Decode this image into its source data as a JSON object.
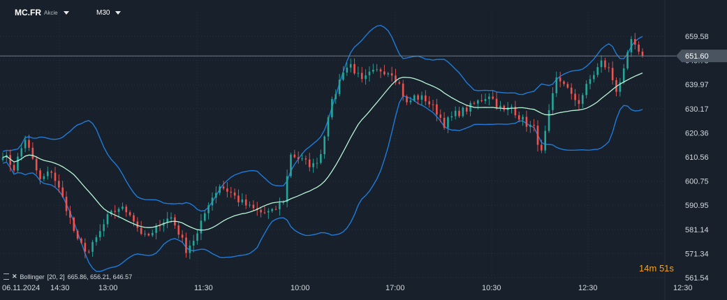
{
  "header": {
    "symbol": "MC.FR",
    "type": "Akcie",
    "timeframe": "M30"
  },
  "legend": {
    "indicator": "Bollinger",
    "params": "[20, 2]",
    "values": "665.86, 656.21, 646.57"
  },
  "timer": {
    "minutes": "14",
    "minutes_unit": "m",
    "seconds": "51",
    "seconds_unit": "s"
  },
  "colors": {
    "background": "#18212b",
    "bull": "#26a69a",
    "bear": "#ef5350",
    "band": "#1e7bd9",
    "middle": "#b8f5d6",
    "grid": "#26313c",
    "price_line": "#7d8793"
  },
  "chart_data": {
    "type": "candlestick",
    "ylim": [
      561.54,
      667.0
    ],
    "y_ticks": [
      "659.58",
      "649.78",
      "639.97",
      "630.17",
      "620.36",
      "610.56",
      "600.75",
      "590.95",
      "581.14",
      "571.34",
      "561.54"
    ],
    "x_ticks": [
      "06.11.2024",
      "14:30",
      "13:00",
      "11:30",
      "10:00",
      "17:00",
      "10:30",
      "12:30",
      "12:30"
    ],
    "current_price": "651.60",
    "path_anchors": [
      [
        0,
        612
      ],
      [
        3,
        606
      ],
      [
        6,
        618
      ],
      [
        8,
        609
      ],
      [
        10,
        601
      ],
      [
        13,
        605
      ],
      [
        17,
        590
      ],
      [
        20,
        576
      ],
      [
        23,
        572
      ],
      [
        26,
        580
      ],
      [
        28,
        586
      ],
      [
        31,
        590
      ],
      [
        34,
        588
      ],
      [
        36,
        582
      ],
      [
        38,
        578
      ],
      [
        40,
        579
      ],
      [
        42,
        584
      ],
      [
        45,
        586
      ],
      [
        47,
        580
      ],
      [
        49,
        573
      ],
      [
        52,
        579
      ],
      [
        55,
        592
      ],
      [
        58,
        599
      ],
      [
        61,
        596
      ],
      [
        63,
        593
      ],
      [
        66,
        590
      ],
      [
        69,
        588
      ],
      [
        72,
        588
      ],
      [
        75,
        593
      ],
      [
        77,
        612
      ],
      [
        80,
        609
      ],
      [
        83,
        607
      ],
      [
        85,
        612
      ],
      [
        87,
        628
      ],
      [
        89,
        637
      ],
      [
        91,
        646
      ],
      [
        93,
        648
      ],
      [
        96,
        641
      ],
      [
        98,
        644
      ],
      [
        101,
        646
      ],
      [
        104,
        645
      ],
      [
        106,
        640
      ],
      [
        108,
        632
      ],
      [
        110,
        635
      ],
      [
        113,
        634
      ],
      [
        116,
        629
      ],
      [
        118,
        624
      ],
      [
        121,
        628
      ],
      [
        124,
        630
      ],
      [
        127,
        633
      ],
      [
        130,
        636
      ],
      [
        132,
        632
      ],
      [
        134,
        629
      ],
      [
        136,
        631
      ],
      [
        138,
        627
      ],
      [
        140,
        624
      ],
      [
        142,
        622
      ],
      [
        144,
        612
      ],
      [
        146,
        628
      ],
      [
        148,
        642
      ],
      [
        150,
        641
      ],
      [
        152,
        635
      ],
      [
        154,
        633
      ],
      [
        157,
        642
      ],
      [
        160,
        649
      ],
      [
        162,
        646
      ],
      [
        164,
        638
      ],
      [
        166,
        645
      ],
      [
        168,
        658
      ],
      [
        170,
        652
      ]
    ],
    "series": [
      {
        "name": "Bollinger upper",
        "values": []
      },
      {
        "name": "Bollinger middle",
        "values": []
      },
      {
        "name": "Bollinger lower",
        "values": []
      }
    ]
  }
}
